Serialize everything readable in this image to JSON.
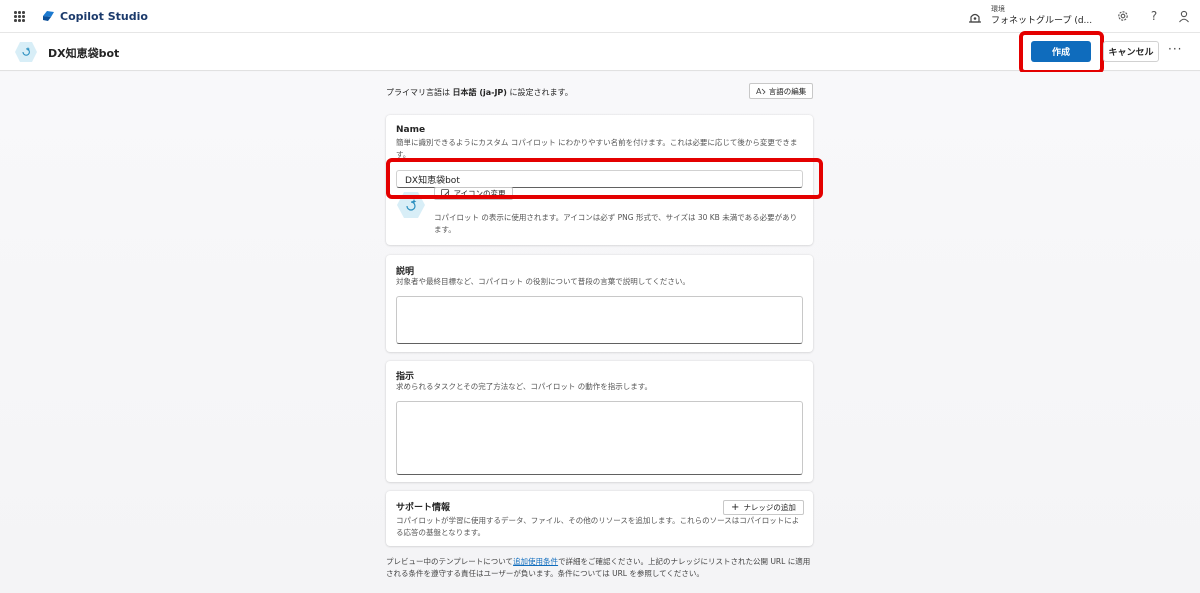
{
  "topbar": {
    "app_name": "Copilot Studio",
    "environment_label": "環境",
    "environment_value": "フォネットグループ (d...",
    "help_icon_glyph": "?",
    "icons": [
      "waffle-icon",
      "copilot-logo-icon",
      "environment-icon",
      "settings-icon",
      "help-icon",
      "account-icon"
    ]
  },
  "header": {
    "bot_name": "DX知恵袋bot",
    "create_label": "作成",
    "cancel_label": "キャンセル",
    "more_label": "···"
  },
  "main": {
    "primary_language_prefix": "プライマリ言語は ",
    "primary_language_value": "日本語 (ja-JP)",
    "primary_language_suffix": " に設定されます。",
    "edit_language_label": "言語の編集"
  },
  "name_card": {
    "title": "Name",
    "description": "簡単に識別できるようにカスタム コパイロット にわかりやすい名前を付けます。これは必要に応じて後から変更できます。",
    "value": "DX知恵袋bot",
    "change_icon_label": "アイコンの変更",
    "icon_description": "コパイロット の表示に使用されます。アイコンは必ず PNG 形式で、サイズは 30 KB 未満である必要があります。"
  },
  "description_card": {
    "title": "説明",
    "description": "対象者や最終目標など、コパイロット の役割について普段の言葉で説明してください。",
    "value": ""
  },
  "instructions_card": {
    "title": "指示",
    "description": "求められるタスクとその完了方法など、コパイロット の動作を指示します。",
    "value": ""
  },
  "support_card": {
    "title": "サポート情報",
    "add_knowledge_label": "ナレッジの追加",
    "description": "コパイロットが学習に使用するデータ、ファイル、その他のリソースを追加します。これらのソースはコパイロットによる応答の基盤となります。"
  },
  "footer": {
    "text_before": "プレビュー中のテンプレートについて",
    "link": "追加使用条件",
    "text_after": "で詳細をご確認ください。上記のナレッジにリストされた公開 URL に適用される条件を遵守する責任はユーザーが負います。条件については URL を参照してください。"
  },
  "colors": {
    "accent": "#0f6cbd",
    "highlight": "#e40000",
    "brand_text": "#1b3a6b"
  }
}
